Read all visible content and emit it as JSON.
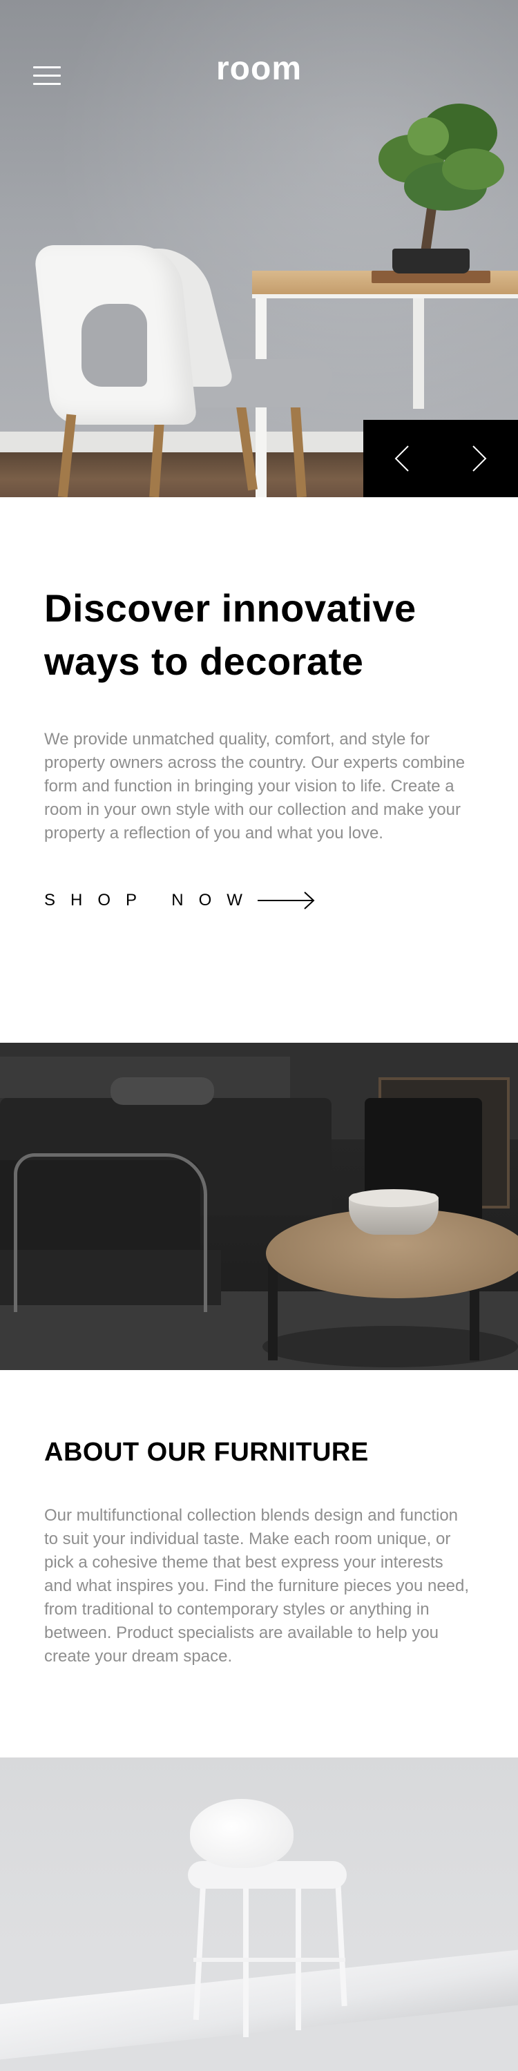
{
  "header": {
    "logo": "room",
    "menu_icon": "hamburger-menu-icon"
  },
  "hero": {
    "prev_icon": "chevron-left-icon",
    "next_icon": "chevron-right-icon"
  },
  "intro": {
    "title": "Discover innovative ways to decorate",
    "body": "We provide unmatched quality, comfort, and style for property owners across the country. Our experts combine form and function in bringing your vision to life. Create a room in your own style with our collection and make your property a reflection of you and what you love.",
    "cta_label": "SHOP NOW",
    "cta_icon": "arrow-right-icon"
  },
  "about": {
    "title": "ABOUT OUR FURNITURE",
    "body": "Our multifunctional collection blends design and function to suit your individual taste. Make each room unique, or pick a cohesive theme that best express your interests and what inspires you. Find the furniture pieces you need, from traditional to contemporary styles or anything in between. Product specialists are available to help you create your dream space."
  },
  "colors": {
    "text_primary": "#000000",
    "text_muted": "#8e8e8e",
    "nav_background": "#000000",
    "background": "#ffffff"
  }
}
